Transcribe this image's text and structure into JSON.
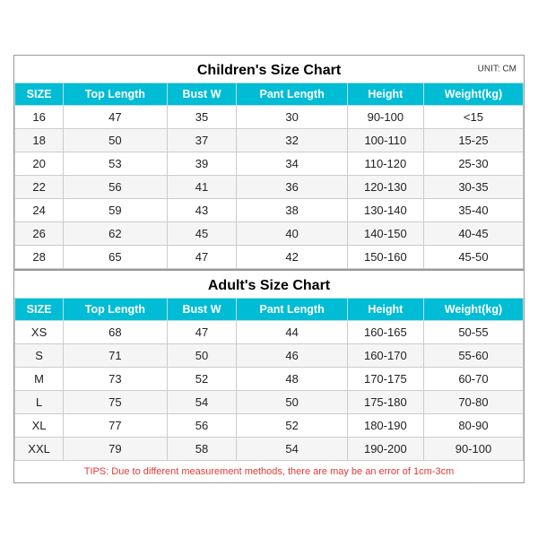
{
  "children_title": "Children's Size Chart",
  "adult_title": "Adult's Size Chart",
  "unit": "UNIT: CM",
  "tips": "TIPS: Due to different measurement methods, there are may be an error of 1cm-3cm",
  "headers": [
    "SIZE",
    "Top Length",
    "Bust W",
    "Pant Length",
    "Height",
    "Weight(kg)"
  ],
  "children_rows": [
    [
      "16",
      "47",
      "35",
      "30",
      "90-100",
      "<15"
    ],
    [
      "18",
      "50",
      "37",
      "32",
      "100-110",
      "15-25"
    ],
    [
      "20",
      "53",
      "39",
      "34",
      "110-120",
      "25-30"
    ],
    [
      "22",
      "56",
      "41",
      "36",
      "120-130",
      "30-35"
    ],
    [
      "24",
      "59",
      "43",
      "38",
      "130-140",
      "35-40"
    ],
    [
      "26",
      "62",
      "45",
      "40",
      "140-150",
      "40-45"
    ],
    [
      "28",
      "65",
      "47",
      "42",
      "150-160",
      "45-50"
    ]
  ],
  "adult_rows": [
    [
      "XS",
      "68",
      "47",
      "44",
      "160-165",
      "50-55"
    ],
    [
      "S",
      "71",
      "50",
      "46",
      "160-170",
      "55-60"
    ],
    [
      "M",
      "73",
      "52",
      "48",
      "170-175",
      "60-70"
    ],
    [
      "L",
      "75",
      "54",
      "50",
      "175-180",
      "70-80"
    ],
    [
      "XL",
      "77",
      "56",
      "52",
      "180-190",
      "80-90"
    ],
    [
      "XXL",
      "79",
      "58",
      "54",
      "190-200",
      "90-100"
    ]
  ]
}
